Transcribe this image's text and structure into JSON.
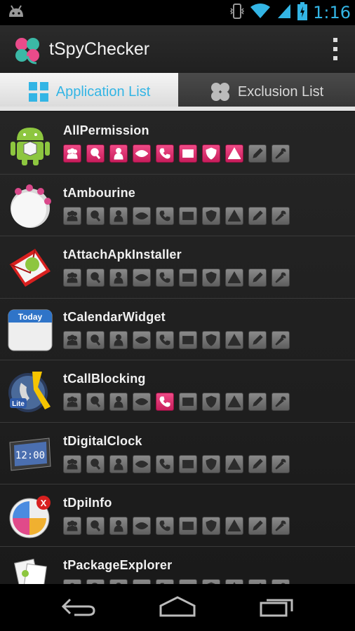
{
  "status_bar": {
    "time": "1:16",
    "icons": [
      "android-debug-icon",
      "vibrate-icon",
      "wifi-icon",
      "signal-icon",
      "battery-icon"
    ]
  },
  "action_bar": {
    "title": "tSpyChecker",
    "logo_icon": "clover-icon",
    "menu_icon": "overflow-menu-icon"
  },
  "tabs": [
    {
      "label": "Application List",
      "icon": "grid-icon",
      "active": true
    },
    {
      "label": "Exclusion List",
      "icon": "clover-icon",
      "active": false
    }
  ],
  "permission_icons": [
    "contacts",
    "search",
    "person",
    "eye",
    "phone",
    "mail",
    "shield",
    "warning",
    "pencil",
    "wrench"
  ],
  "apps": [
    {
      "name": "AllPermission",
      "icon": "android-icon",
      "perms": [
        1,
        1,
        1,
        1,
        1,
        1,
        1,
        1,
        0,
        0
      ]
    },
    {
      "name": "tAmbourine",
      "icon": "tambourine-icon",
      "perms": [
        0,
        0,
        0,
        0,
        0,
        0,
        0,
        0,
        0,
        0
      ]
    },
    {
      "name": "tAttachApkInstaller",
      "icon": "envelope-android-icon",
      "perms": [
        0,
        0,
        0,
        0,
        0,
        0,
        0,
        0,
        0,
        0
      ]
    },
    {
      "name": "tCalendarWidget",
      "icon": "calendar-icon",
      "perms": [
        0,
        0,
        0,
        0,
        0,
        0,
        0,
        0,
        0,
        0
      ]
    },
    {
      "name": "tCallBlocking",
      "icon": "call-blocking-icon",
      "perms": [
        0,
        0,
        0,
        0,
        1,
        0,
        0,
        0,
        0,
        0
      ]
    },
    {
      "name": "tDigitalClock",
      "icon": "digital-clock-icon",
      "perms": [
        0,
        0,
        0,
        0,
        0,
        0,
        0,
        0,
        0,
        0
      ]
    },
    {
      "name": "tDpiInfo",
      "icon": "dpi-info-icon",
      "perms": [
        0,
        0,
        0,
        0,
        0,
        0,
        0,
        0,
        0,
        0
      ]
    },
    {
      "name": "tPackageExplorer",
      "icon": "package-explorer-icon",
      "perms": [
        0,
        0,
        0,
        0,
        0,
        0,
        0,
        0,
        0,
        0
      ]
    }
  ],
  "icon_labels": {
    "calendar": "Today",
    "call_blocking": "Lite",
    "clock": "12:00",
    "dpi_badge": "X"
  },
  "colors": {
    "accent": "#33b5e5",
    "permission_on": "#e0306e",
    "permission_off": "#6e6e6e"
  }
}
